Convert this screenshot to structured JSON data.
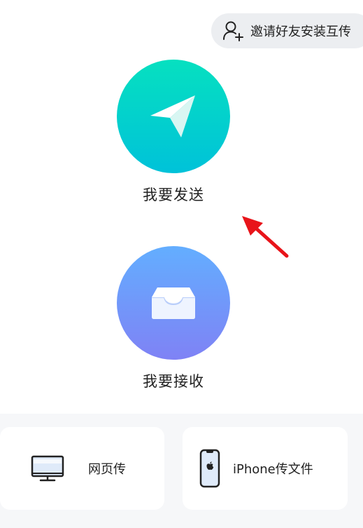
{
  "invite": {
    "label": "邀请好友安装互传",
    "icon": "add-user-icon"
  },
  "send": {
    "label": "我要发送",
    "icon": "paper-plane-icon",
    "colors": [
      "#06e0c0",
      "#00c2d9"
    ]
  },
  "receive": {
    "label": "我要接收",
    "icon": "inbox-tray-icon",
    "colors": [
      "#63aeff",
      "#7f82f5"
    ]
  },
  "annotation": {
    "icon": "red-arrow-icon",
    "color": "#e8141a"
  },
  "cards": {
    "web": {
      "label": "网页传",
      "icon": "monitor-icon"
    },
    "iphone": {
      "label": "iPhone传文件",
      "icon": "iphone-icon"
    }
  }
}
